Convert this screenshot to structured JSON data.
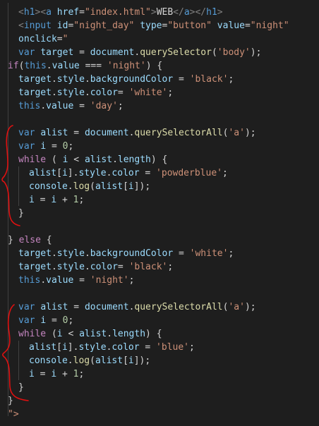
{
  "editor": {
    "theme": "dark",
    "background": "#1e1e1e",
    "colors": {
      "tag": "#569cd6",
      "attribute": "#9cdcfe",
      "string": "#ce9178",
      "keyword": "#569cd6",
      "control": "#c586c0",
      "function": "#dcdcaa",
      "number": "#b5cea8",
      "text": "#d4d4d4",
      "annotation": "#e01010"
    },
    "lines": [
      {
        "indent": 1,
        "tokens": [
          {
            "t": "<",
            "c": "punct"
          },
          {
            "t": "h1",
            "c": "tag"
          },
          {
            "t": ">",
            "c": "punct"
          },
          {
            "t": "<",
            "c": "punct"
          },
          {
            "t": "a",
            "c": "tag"
          },
          {
            "t": " "
          },
          {
            "t": "href",
            "c": "attr"
          },
          {
            "t": "=",
            "c": "txt"
          },
          {
            "t": "\"index.html\"",
            "c": "str"
          },
          {
            "t": ">",
            "c": "punct"
          },
          {
            "t": "WEB",
            "c": "txt"
          },
          {
            "t": "</",
            "c": "punct"
          },
          {
            "t": "a",
            "c": "tag"
          },
          {
            "t": ">",
            "c": "punct"
          },
          {
            "t": "</",
            "c": "punct"
          },
          {
            "t": "h1",
            "c": "tag"
          },
          {
            "t": ">",
            "c": "punct"
          }
        ]
      },
      {
        "indent": 1,
        "tokens": [
          {
            "t": "<",
            "c": "punct"
          },
          {
            "t": "input",
            "c": "tag"
          },
          {
            "t": " "
          },
          {
            "t": "id",
            "c": "attr"
          },
          {
            "t": "=",
            "c": "txt"
          },
          {
            "t": "\"night_day\"",
            "c": "str"
          },
          {
            "t": " "
          },
          {
            "t": "type",
            "c": "attr"
          },
          {
            "t": "=",
            "c": "txt"
          },
          {
            "t": "\"button\"",
            "c": "str"
          },
          {
            "t": " "
          },
          {
            "t": "value",
            "c": "attr"
          },
          {
            "t": "=",
            "c": "txt"
          },
          {
            "t": "\"night\"",
            "c": "str"
          }
        ]
      },
      {
        "indent": 1,
        "tokens": [
          {
            "t": "onclick",
            "c": "attr"
          },
          {
            "t": "=",
            "c": "txt"
          },
          {
            "t": "\"",
            "c": "str"
          }
        ]
      },
      {
        "indent": 1,
        "tokens": [
          {
            "t": "var",
            "c": "kw"
          },
          {
            "t": " "
          },
          {
            "t": "target",
            "c": "var"
          },
          {
            "t": " = ",
            "c": "op"
          },
          {
            "t": "document",
            "c": "var"
          },
          {
            "t": ".",
            "c": "op"
          },
          {
            "t": "querySelector",
            "c": "fn"
          },
          {
            "t": "(",
            "c": "op"
          },
          {
            "t": "'body'",
            "c": "str"
          },
          {
            "t": ");",
            "c": "op"
          }
        ]
      },
      {
        "indent": 0,
        "tokens": [
          {
            "t": "if",
            "c": "ctrl"
          },
          {
            "t": "(",
            "c": "op"
          },
          {
            "t": "this",
            "c": "kw"
          },
          {
            "t": ".",
            "c": "op"
          },
          {
            "t": "value",
            "c": "var"
          },
          {
            "t": " === ",
            "c": "op"
          },
          {
            "t": "'night'",
            "c": "str"
          },
          {
            "t": ") {",
            "c": "op"
          }
        ]
      },
      {
        "indent": 1,
        "tokens": [
          {
            "t": "target",
            "c": "var"
          },
          {
            "t": ".",
            "c": "op"
          },
          {
            "t": "style",
            "c": "var"
          },
          {
            "t": ".",
            "c": "op"
          },
          {
            "t": "backgroundColor",
            "c": "var"
          },
          {
            "t": " = ",
            "c": "op"
          },
          {
            "t": "'black'",
            "c": "str"
          },
          {
            "t": ";",
            "c": "op"
          }
        ]
      },
      {
        "indent": 1,
        "tokens": [
          {
            "t": "target",
            "c": "var"
          },
          {
            "t": ".",
            "c": "op"
          },
          {
            "t": "style",
            "c": "var"
          },
          {
            "t": ".",
            "c": "op"
          },
          {
            "t": "color",
            "c": "var"
          },
          {
            "t": "= ",
            "c": "op"
          },
          {
            "t": "'white'",
            "c": "str"
          },
          {
            "t": ";",
            "c": "op"
          }
        ]
      },
      {
        "indent": 1,
        "tokens": [
          {
            "t": "this",
            "c": "kw"
          },
          {
            "t": ".",
            "c": "op"
          },
          {
            "t": "value",
            "c": "var"
          },
          {
            "t": " = ",
            "c": "op"
          },
          {
            "t": "'day'",
            "c": "str"
          },
          {
            "t": ";",
            "c": "op"
          }
        ]
      },
      {
        "indent": 0,
        "tokens": []
      },
      {
        "indent": 1,
        "tokens": [
          {
            "t": "var",
            "c": "kw"
          },
          {
            "t": " "
          },
          {
            "t": "alist",
            "c": "var"
          },
          {
            "t": " = ",
            "c": "op"
          },
          {
            "t": "document",
            "c": "var"
          },
          {
            "t": ".",
            "c": "op"
          },
          {
            "t": "querySelectorAll",
            "c": "fn"
          },
          {
            "t": "(",
            "c": "op"
          },
          {
            "t": "'a'",
            "c": "str"
          },
          {
            "t": ");",
            "c": "op"
          }
        ]
      },
      {
        "indent": 1,
        "tokens": [
          {
            "t": "var",
            "c": "kw"
          },
          {
            "t": " "
          },
          {
            "t": "i",
            "c": "var"
          },
          {
            "t": " = ",
            "c": "op"
          },
          {
            "t": "0",
            "c": "num"
          },
          {
            "t": ";",
            "c": "op"
          }
        ]
      },
      {
        "indent": 1,
        "tokens": [
          {
            "t": "while",
            "c": "ctrl"
          },
          {
            "t": " ( ",
            "c": "op"
          },
          {
            "t": "i",
            "c": "var"
          },
          {
            "t": " < ",
            "c": "op"
          },
          {
            "t": "alist",
            "c": "var"
          },
          {
            "t": ".",
            "c": "op"
          },
          {
            "t": "length",
            "c": "var"
          },
          {
            "t": ") {",
            "c": "op"
          }
        ]
      },
      {
        "indent": 2,
        "tokens": [
          {
            "t": "alist",
            "c": "var"
          },
          {
            "t": "[",
            "c": "op"
          },
          {
            "t": "i",
            "c": "var"
          },
          {
            "t": "].",
            "c": "op"
          },
          {
            "t": "style",
            "c": "var"
          },
          {
            "t": ".",
            "c": "op"
          },
          {
            "t": "color",
            "c": "var"
          },
          {
            "t": " = ",
            "c": "op"
          },
          {
            "t": "'powderblue'",
            "c": "str"
          },
          {
            "t": ";",
            "c": "op"
          }
        ]
      },
      {
        "indent": 2,
        "tokens": [
          {
            "t": "console",
            "c": "var"
          },
          {
            "t": ".",
            "c": "op"
          },
          {
            "t": "log",
            "c": "fn"
          },
          {
            "t": "(",
            "c": "op"
          },
          {
            "t": "alist",
            "c": "var"
          },
          {
            "t": "[",
            "c": "op"
          },
          {
            "t": "i",
            "c": "var"
          },
          {
            "t": "]);",
            "c": "op"
          }
        ]
      },
      {
        "indent": 2,
        "tokens": [
          {
            "t": "i",
            "c": "var"
          },
          {
            "t": " = ",
            "c": "op"
          },
          {
            "t": "i",
            "c": "var"
          },
          {
            "t": " + ",
            "c": "op"
          },
          {
            "t": "1",
            "c": "num"
          },
          {
            "t": ";",
            "c": "op"
          }
        ]
      },
      {
        "indent": 1,
        "tokens": [
          {
            "t": "}",
            "c": "op"
          }
        ]
      },
      {
        "indent": 0,
        "tokens": []
      },
      {
        "indent": 0,
        "tokens": [
          {
            "t": "} ",
            "c": "op"
          },
          {
            "t": "else",
            "c": "ctrl"
          },
          {
            "t": " {",
            "c": "op"
          }
        ]
      },
      {
        "indent": 1,
        "tokens": [
          {
            "t": "target",
            "c": "var"
          },
          {
            "t": ".",
            "c": "op"
          },
          {
            "t": "style",
            "c": "var"
          },
          {
            "t": ".",
            "c": "op"
          },
          {
            "t": "backgroundColor",
            "c": "var"
          },
          {
            "t": " = ",
            "c": "op"
          },
          {
            "t": "'white'",
            "c": "str"
          },
          {
            "t": ";",
            "c": "op"
          }
        ]
      },
      {
        "indent": 1,
        "tokens": [
          {
            "t": "target",
            "c": "var"
          },
          {
            "t": ".",
            "c": "op"
          },
          {
            "t": "style",
            "c": "var"
          },
          {
            "t": ".",
            "c": "op"
          },
          {
            "t": "color",
            "c": "var"
          },
          {
            "t": "= ",
            "c": "op"
          },
          {
            "t": "'black'",
            "c": "str"
          },
          {
            "t": ";",
            "c": "op"
          }
        ]
      },
      {
        "indent": 1,
        "tokens": [
          {
            "t": "this",
            "c": "kw"
          },
          {
            "t": ".",
            "c": "op"
          },
          {
            "t": "value",
            "c": "var"
          },
          {
            "t": " = ",
            "c": "op"
          },
          {
            "t": "'night'",
            "c": "str"
          },
          {
            "t": ";",
            "c": "op"
          }
        ]
      },
      {
        "indent": 0,
        "tokens": []
      },
      {
        "indent": 1,
        "tokens": [
          {
            "t": "var",
            "c": "kw"
          },
          {
            "t": " "
          },
          {
            "t": "alist",
            "c": "var"
          },
          {
            "t": " = ",
            "c": "op"
          },
          {
            "t": "document",
            "c": "var"
          },
          {
            "t": ".",
            "c": "op"
          },
          {
            "t": "querySelectorAll",
            "c": "fn"
          },
          {
            "t": "(",
            "c": "op"
          },
          {
            "t": "'a'",
            "c": "str"
          },
          {
            "t": ");",
            "c": "op"
          }
        ]
      },
      {
        "indent": 1,
        "tokens": [
          {
            "t": "var",
            "c": "kw"
          },
          {
            "t": " "
          },
          {
            "t": "i",
            "c": "var"
          },
          {
            "t": " = ",
            "c": "op"
          },
          {
            "t": "0",
            "c": "num"
          },
          {
            "t": ";",
            "c": "op"
          }
        ]
      },
      {
        "indent": 1,
        "tokens": [
          {
            "t": "while",
            "c": "ctrl"
          },
          {
            "t": " (",
            "c": "op"
          },
          {
            "t": "i",
            "c": "var"
          },
          {
            "t": " < ",
            "c": "op"
          },
          {
            "t": "alist",
            "c": "var"
          },
          {
            "t": ".",
            "c": "op"
          },
          {
            "t": "length",
            "c": "var"
          },
          {
            "t": ") {",
            "c": "op"
          }
        ]
      },
      {
        "indent": 2,
        "tokens": [
          {
            "t": "alist",
            "c": "var"
          },
          {
            "t": "[",
            "c": "op"
          },
          {
            "t": "i",
            "c": "var"
          },
          {
            "t": "].",
            "c": "op"
          },
          {
            "t": "style",
            "c": "var"
          },
          {
            "t": ".",
            "c": "op"
          },
          {
            "t": "color",
            "c": "var"
          },
          {
            "t": " = ",
            "c": "op"
          },
          {
            "t": "'blue'",
            "c": "str"
          },
          {
            "t": ";",
            "c": "op"
          }
        ]
      },
      {
        "indent": 2,
        "tokens": [
          {
            "t": "console",
            "c": "var"
          },
          {
            "t": ".",
            "c": "op"
          },
          {
            "t": "log",
            "c": "fn"
          },
          {
            "t": "(",
            "c": "op"
          },
          {
            "t": "alist",
            "c": "var"
          },
          {
            "t": "[",
            "c": "op"
          },
          {
            "t": "i",
            "c": "var"
          },
          {
            "t": "]);",
            "c": "op"
          }
        ]
      },
      {
        "indent": 2,
        "tokens": [
          {
            "t": "i",
            "c": "var"
          },
          {
            "t": " = ",
            "c": "op"
          },
          {
            "t": "i",
            "c": "var"
          },
          {
            "t": " + ",
            "c": "op"
          },
          {
            "t": "1",
            "c": "num"
          },
          {
            "t": ";",
            "c": "op"
          }
        ]
      },
      {
        "indent": 1,
        "tokens": [
          {
            "t": "}",
            "c": "op"
          }
        ]
      },
      {
        "indent": 0,
        "tokens": [
          {
            "t": "}",
            "c": "op"
          }
        ]
      },
      {
        "indent": 0,
        "tokens": [
          {
            "t": "\">",
            "c": "str"
          }
        ]
      }
    ]
  }
}
